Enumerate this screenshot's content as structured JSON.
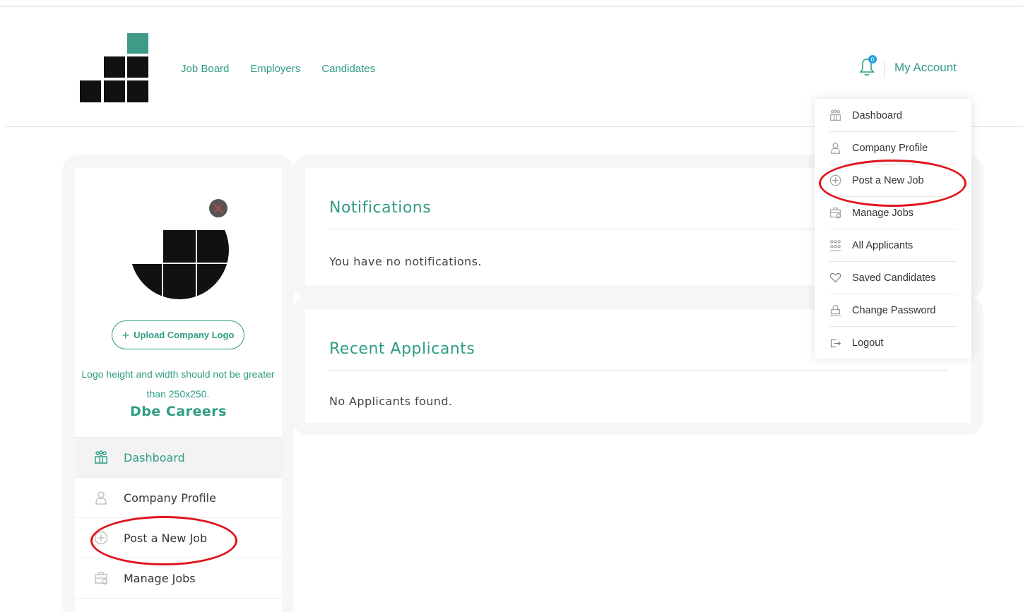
{
  "header": {
    "nav": [
      "Job Board",
      "Employers",
      "Candidates"
    ],
    "notification_count": "0",
    "account_label": "My Account"
  },
  "account_menu": [
    {
      "label": "Dashboard",
      "icon": "dashboard-icon"
    },
    {
      "label": "Company Profile",
      "icon": "user-icon"
    },
    {
      "label": "Post a New Job",
      "icon": "plus-circle-icon"
    },
    {
      "label": "Manage Jobs",
      "icon": "briefcase-icon"
    },
    {
      "label": "All Applicants",
      "icon": "group-icon"
    },
    {
      "label": "Saved Candidates",
      "icon": "heart-icon"
    },
    {
      "label": "Change Password",
      "icon": "lock-icon"
    },
    {
      "label": "Logout",
      "icon": "logout-icon"
    }
  ],
  "sidebar": {
    "upload_label": "Upload Company Logo",
    "logo_note": "Logo height and width should not be greater than 250x250.",
    "company_name": "Dbe Careers",
    "items": [
      {
        "label": "Dashboard",
        "icon": "dashboard-icon",
        "active": true
      },
      {
        "label": "Company Profile",
        "icon": "user-icon"
      },
      {
        "label": "Post a New Job",
        "icon": "plus-circle-icon"
      },
      {
        "label": "Manage Jobs",
        "icon": "briefcase-icon"
      }
    ]
  },
  "notifications": {
    "title": "Notifications",
    "empty_text": "You have no notifications."
  },
  "applicants": {
    "title": "Recent Applicants",
    "empty_text": "No Applicants found."
  },
  "colors": {
    "accent": "#2f9d84",
    "annotation": "#e0141b"
  }
}
